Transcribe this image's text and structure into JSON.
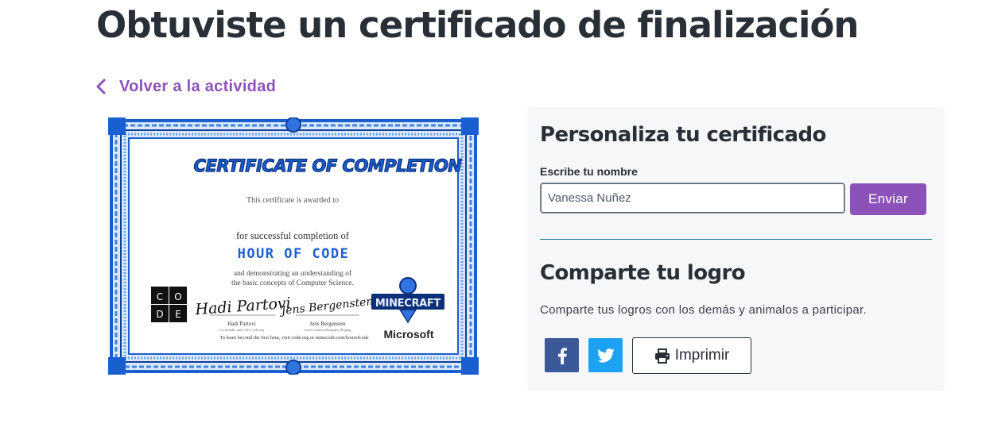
{
  "page": {
    "title": "Obtuviste un certificado de finalización"
  },
  "back_link": {
    "label": "Volver a la actividad"
  },
  "certificate": {
    "heading": "CERTIFICATE OF COMPLETION",
    "awarded_text": "This certificate is awarded to",
    "completion_text": "for successful completion of",
    "course_name": "HOUR OF CODE",
    "understanding_line1": "and demonstrating an understanding of",
    "understanding_line2": "the basic concepts of Computer Science.",
    "code_logo_letters": [
      "C",
      "O",
      "D",
      "E"
    ],
    "signer1_signature": "Hadi Partovi",
    "signer1_name": "Hadi Partovi",
    "signer1_title": "Co-founder and CEO Code.org",
    "signer2_signature": "Jens Bergensten",
    "signer2_name": "Jens Bergensten",
    "signer2_title": "Lead Creative Designer, Mojang",
    "footer_text": "To learn beyond the first hour, visit code.org or minecraft.com/hourofcode",
    "minecraft_logo": "MINECRAFT",
    "microsoft_logo": "Microsoft"
  },
  "panel": {
    "personalize_heading": "Personaliza tu certificado",
    "name_label": "Escribe tu nombre",
    "name_value": "Vanessa Nuñez",
    "submit_label": "Enviar",
    "share_heading": "Comparte tu logro",
    "share_text": "Comparte tus logros con los demás y animalos a participar.",
    "facebook_icon": "facebook-icon",
    "twitter_icon": "twitter-icon",
    "print_label": "Imprimir"
  },
  "colors": {
    "accent": "#8c52ba",
    "title": "#292f36",
    "panel_bg": "#f6f7f9",
    "divider": "#1a7a93",
    "facebook": "#3b5998",
    "twitter": "#1da1f2",
    "cert_blue": "#1a5fd0"
  }
}
